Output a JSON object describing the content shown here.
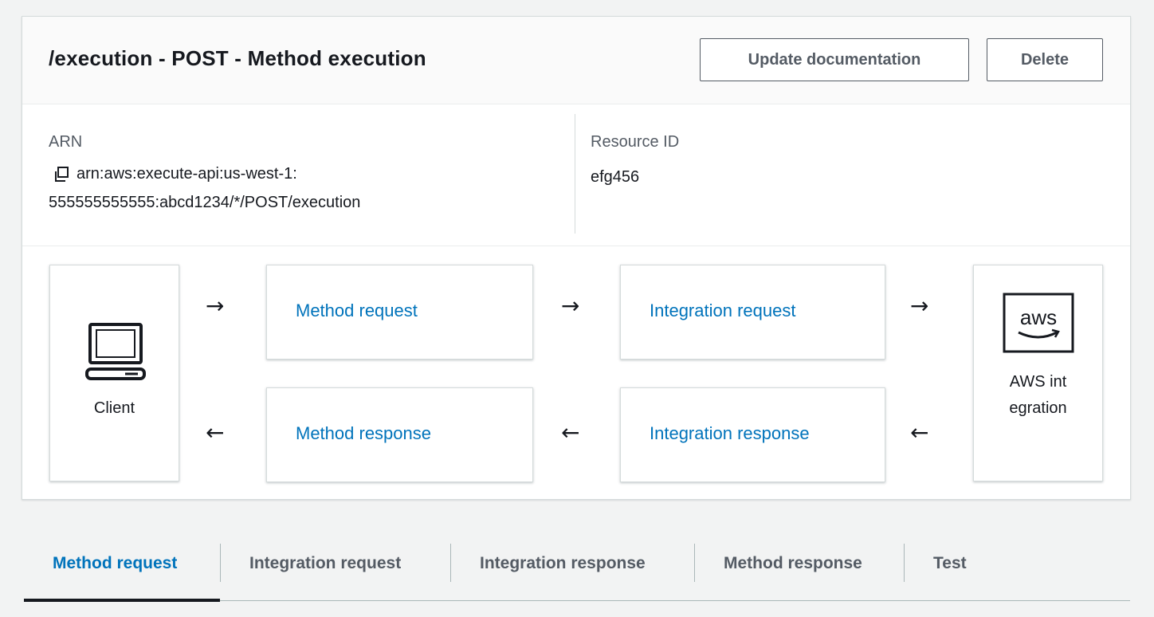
{
  "header": {
    "title": "/execution - POST - Method execution",
    "update_label": "Update documentation",
    "delete_label": "Delete"
  },
  "info": {
    "arn_label": "ARN",
    "arn_line1": "arn:aws:execute-api:us-west-1:",
    "arn_line2": "555555555555:abcd1234/*/POST/execution",
    "resource_id_label": "Resource ID",
    "resource_id_value": "efg456"
  },
  "flow": {
    "client_label": "Client",
    "method_request": "Method request",
    "integration_request": "Integration request",
    "method_response": "Method response",
    "integration_response": "Integration response",
    "aws_integration_label": "AWS integration",
    "arrow_right": "→",
    "arrow_left": "←"
  },
  "tabs": [
    {
      "label": "Method request",
      "active": true
    },
    {
      "label": "Integration request",
      "active": false
    },
    {
      "label": "Integration response",
      "active": false
    },
    {
      "label": "Method response",
      "active": false
    },
    {
      "label": "Test",
      "active": false
    }
  ],
  "colors": {
    "link": "#0073bb",
    "background": "#f2f3f3",
    "text": "#16191f",
    "muted": "#545b64"
  },
  "icons": [
    "copy-icon",
    "laptop-icon",
    "aws-logo-icon",
    "arrow-right-icon",
    "arrow-left-icon"
  ]
}
